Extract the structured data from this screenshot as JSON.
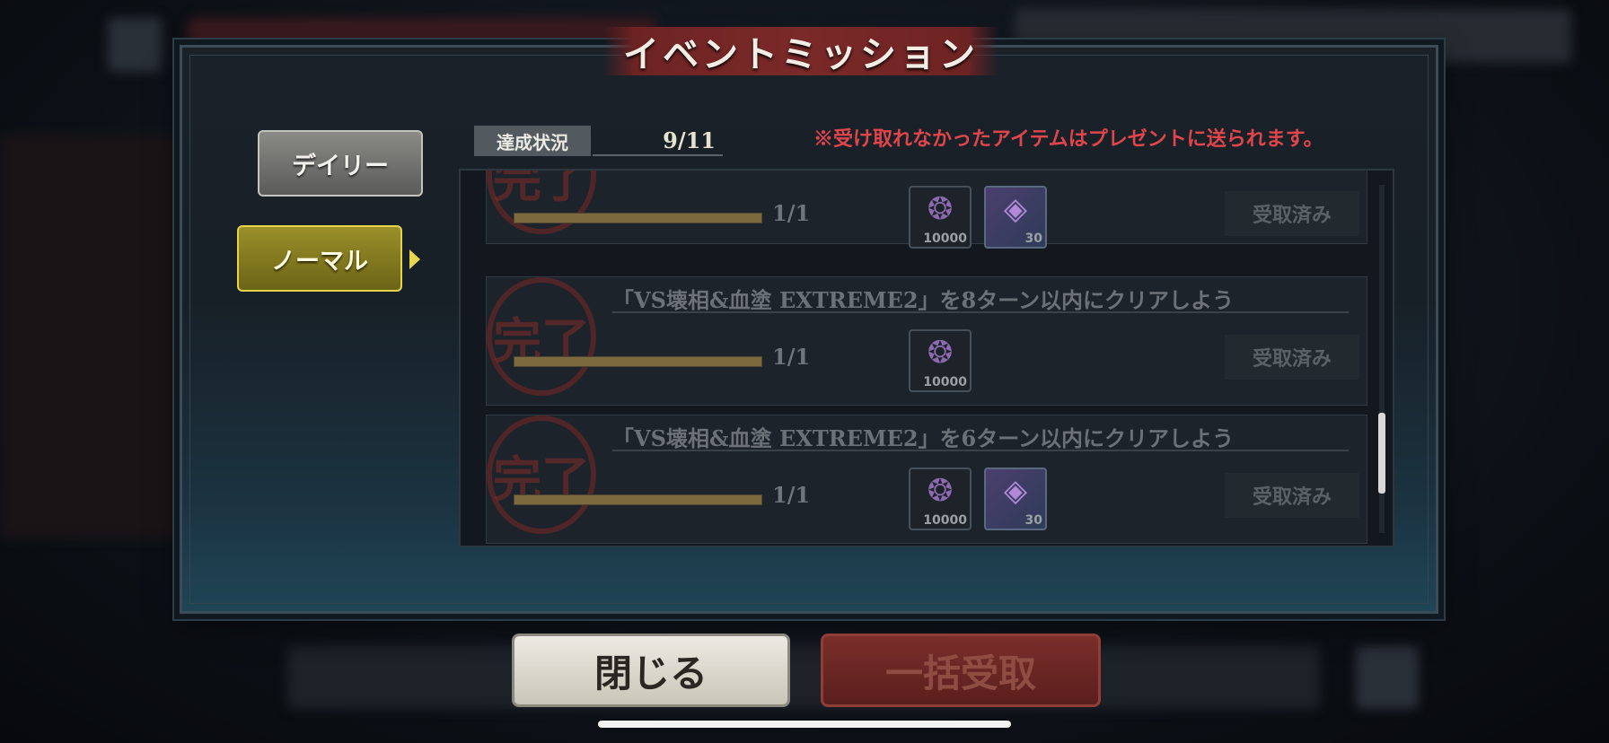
{
  "title": "イベントミッション",
  "tabs": [
    {
      "label": "デイリー",
      "active": false
    },
    {
      "label": "ノーマル",
      "active": true
    }
  ],
  "progress": {
    "label": "達成状況",
    "value": "9/11"
  },
  "notice": "※受け取れなかったアイテムはプレゼントに送られます。",
  "stamp_text": "完了",
  "missions": [
    {
      "title": "",
      "progress_text": "1/1",
      "progress_fraction": 1.0,
      "rewards": [
        {
          "icon": "curse-crystal-icon",
          "qty": "10000"
        },
        {
          "icon": "cube-item-icon",
          "qty": "30"
        }
      ],
      "status": "受取済み"
    },
    {
      "title": "「VS壊相&血塗 EXTREME2」を8ターン以内にクリアしよう",
      "progress_text": "1/1",
      "progress_fraction": 1.0,
      "rewards": [
        {
          "icon": "curse-crystal-icon",
          "qty": "10000"
        }
      ],
      "status": "受取済み"
    },
    {
      "title": "「VS壊相&血塗 EXTREME2」を6ターン以内にクリアしよう",
      "progress_text": "1/1",
      "progress_fraction": 1.0,
      "rewards": [
        {
          "icon": "curse-crystal-icon",
          "qty": "10000"
        },
        {
          "icon": "cube-item-icon",
          "qty": "30"
        }
      ],
      "status": "受取済み"
    }
  ],
  "buttons": {
    "close": "閉じる",
    "claim_all": "一括受取"
  },
  "colors": {
    "notice": "#e0454c",
    "active_tab": "#9a8f2a",
    "title_banner": "#7a2a28"
  }
}
